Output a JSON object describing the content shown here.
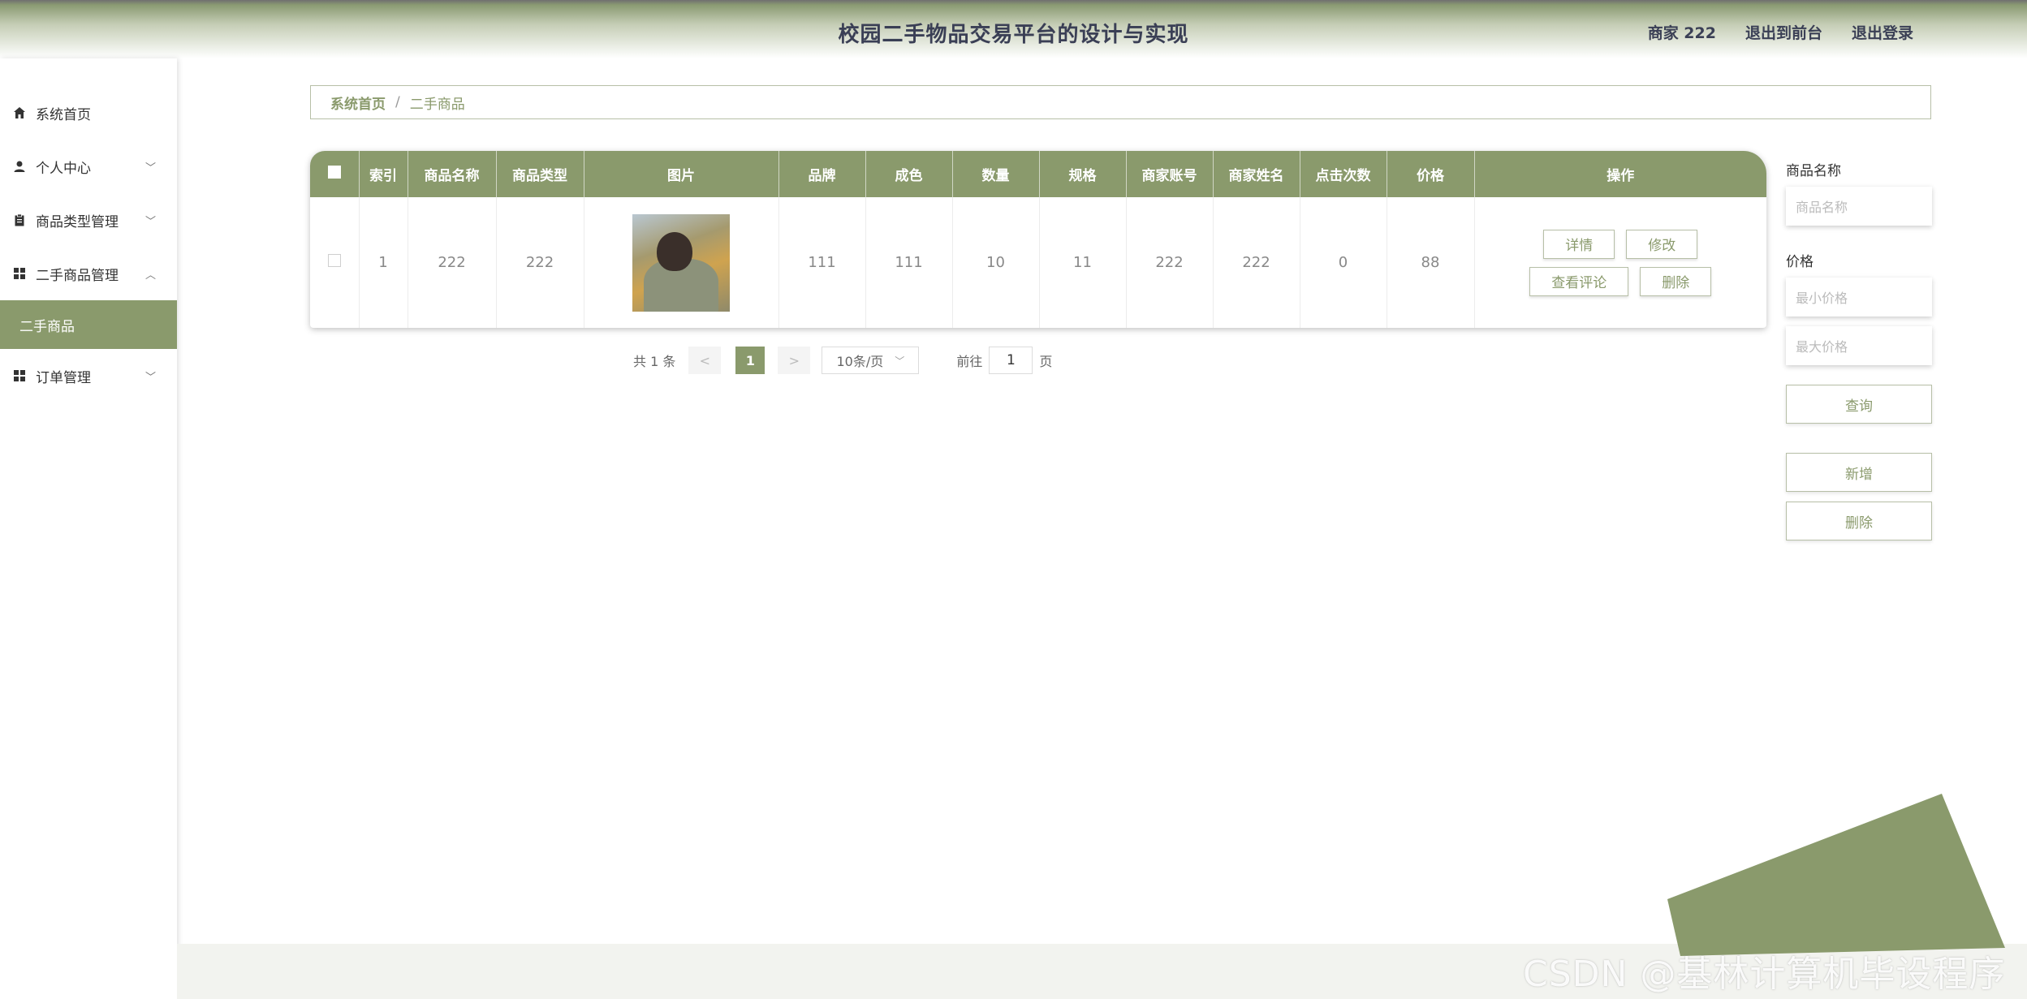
{
  "header": {
    "title": "校园二手物品交易平台的设计与实现",
    "user": "商家 222",
    "to_front": "退出到前台",
    "logout": "退出登录"
  },
  "sidebar": {
    "items": [
      {
        "label": "系统首页",
        "icon": "home-icon"
      },
      {
        "label": "个人中心",
        "icon": "user-icon"
      },
      {
        "label": "商品类型管理",
        "icon": "clipboard-icon"
      },
      {
        "label": "二手商品管理",
        "icon": "grid-icon"
      },
      {
        "label": "二手商品",
        "icon": ""
      },
      {
        "label": "订单管理",
        "icon": "grid-icon"
      }
    ]
  },
  "breadcrumb": {
    "home": "系统首页",
    "sep": "/",
    "current": "二手商品"
  },
  "table": {
    "columns": [
      "索引",
      "商品名称",
      "商品类型",
      "图片",
      "品牌",
      "成色",
      "数量",
      "规格",
      "商家账号",
      "商家姓名",
      "点击次数",
      "价格",
      "操作"
    ],
    "rows": [
      {
        "index": "1",
        "name": "222",
        "type": "222",
        "brand": "111",
        "condition": "111",
        "quantity": "10",
        "spec": "11",
        "merchant_account": "222",
        "merchant_name": "222",
        "clicks": "0",
        "price": "88"
      }
    ],
    "actions": {
      "detail": "详情",
      "edit": "修改",
      "comments": "查看评论",
      "delete": "删除"
    }
  },
  "pagination": {
    "total": "共 1 条",
    "prev": "<",
    "current": "1",
    "next": ">",
    "page_size": "10条/页",
    "goto_label": "前往",
    "goto_value": "1",
    "page_unit": "页"
  },
  "search": {
    "name_label": "商品名称",
    "name_placeholder": "商品名称",
    "price_label": "价格",
    "min_placeholder": "最小价格",
    "max_placeholder": "最大价格",
    "query": "查询",
    "add": "新增",
    "delete": "删除"
  },
  "watermark": "CSDN @基林计算机毕设程序",
  "colors": {
    "accent": "#8a9a6c",
    "header_text": "#3a3f55"
  }
}
